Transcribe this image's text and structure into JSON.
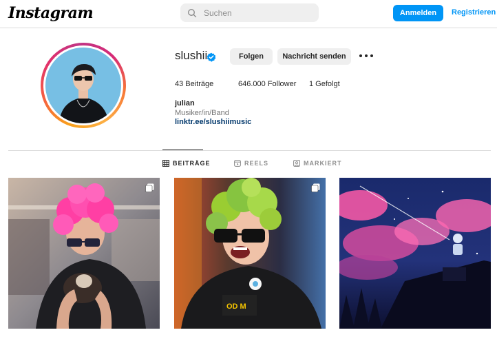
{
  "nav": {
    "logo": "Instagram",
    "search_placeholder": "Suchen",
    "login_label": "Anmelden",
    "register_label": "Registrieren"
  },
  "profile": {
    "username": "slushii",
    "verified": true,
    "follow_label": "Folgen",
    "message_label": "Nachricht senden",
    "stats": {
      "posts": "43 Beiträge",
      "followers": "646.000 Follower",
      "following": "1 Gefolgt"
    },
    "full_name": "julian",
    "category": "Musiker/in/Band",
    "link": "linktr.ee/slushiimusic"
  },
  "tabs": [
    {
      "label": "BEITRÄGE",
      "active": true,
      "icon": "grid-icon"
    },
    {
      "label": "REELS",
      "active": false,
      "icon": "reels-icon"
    },
    {
      "label": "MARKIERT",
      "active": false,
      "icon": "tagged-icon"
    }
  ],
  "posts": [
    {
      "icon": "carousel-icon",
      "subject": "pink-haired person holding a small dog"
    },
    {
      "icon": "carousel-icon",
      "subject": "green-haired person with sunglasses smiling"
    },
    {
      "icon": null,
      "subject": "night sky illustration with pink clouds"
    }
  ],
  "colors": {
    "accent": "#0095f6",
    "link": "#00376b",
    "verified": "#0095f6"
  }
}
